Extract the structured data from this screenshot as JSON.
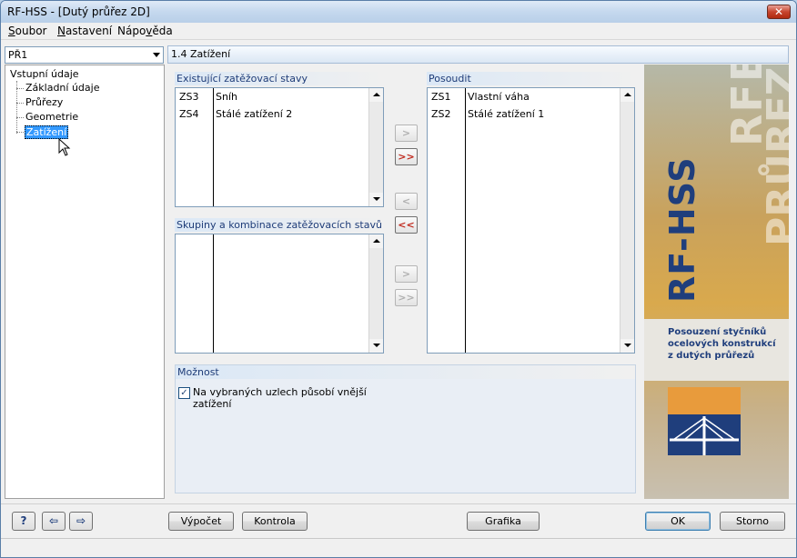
{
  "window": {
    "title": "RF-HSS - [Dutý průřez 2D]",
    "close_label": "✕"
  },
  "menu": [
    {
      "label": "Soubor",
      "accel": "S"
    },
    {
      "label": "Nastavení",
      "accel": "N"
    },
    {
      "label": "Nápověda",
      "accel": "v"
    }
  ],
  "nav": {
    "combo_value": "PŘ1",
    "root": "Vstupní údaje",
    "items": [
      "Základní údaje",
      "Průřezy",
      "Geometrie",
      "Zatížení"
    ],
    "selected": "Zatížení"
  },
  "section_title": "1.4 Zatížení",
  "existing": {
    "title": "Existující zatěžovací stavy",
    "rows": [
      {
        "id": "ZS3",
        "name": "Sníh"
      },
      {
        "id": "ZS4",
        "name": "Stálé zatížení 2"
      }
    ]
  },
  "groups": {
    "title": "Skupiny a kombinace zatěžovacích stavů",
    "rows": []
  },
  "check": {
    "title": "Posoudit",
    "rows": [
      {
        "id": "ZS1",
        "name": "Vlastní váha"
      },
      {
        "id": "ZS2",
        "name": "Stálé zatížení 1"
      }
    ]
  },
  "transfer": {
    "add_one": ">",
    "add_all": ">>",
    "remove_one": "<",
    "remove_all": "<<",
    "add_one_groups": ">",
    "add_all_groups": ">>"
  },
  "option": {
    "title": "Možnost",
    "checkbox_label": "Na vybraných uzlech působí vnější zatížení",
    "checked": true,
    "check_mark": "✓"
  },
  "banner": {
    "product": "RF-HSS",
    "watermark1": "RFEM",
    "watermark2": "PRŮREZ",
    "description_lines": [
      "Posouzení styčníků",
      "ocelových konstrukcí",
      "z dutých průřezů"
    ]
  },
  "buttons": {
    "help": "?",
    "nav_prev": "⇦",
    "nav_next": "⇨",
    "calculate": "Výpočet",
    "control": "Kontrola",
    "graphics": "Grafika",
    "ok": "OK",
    "cancel": "Storno"
  },
  "colors": {
    "selection": "#3399ff",
    "group_title": "#1e3c78",
    "banner_blue": "#1f3e7c",
    "banner_orange": "#e89b3c"
  }
}
